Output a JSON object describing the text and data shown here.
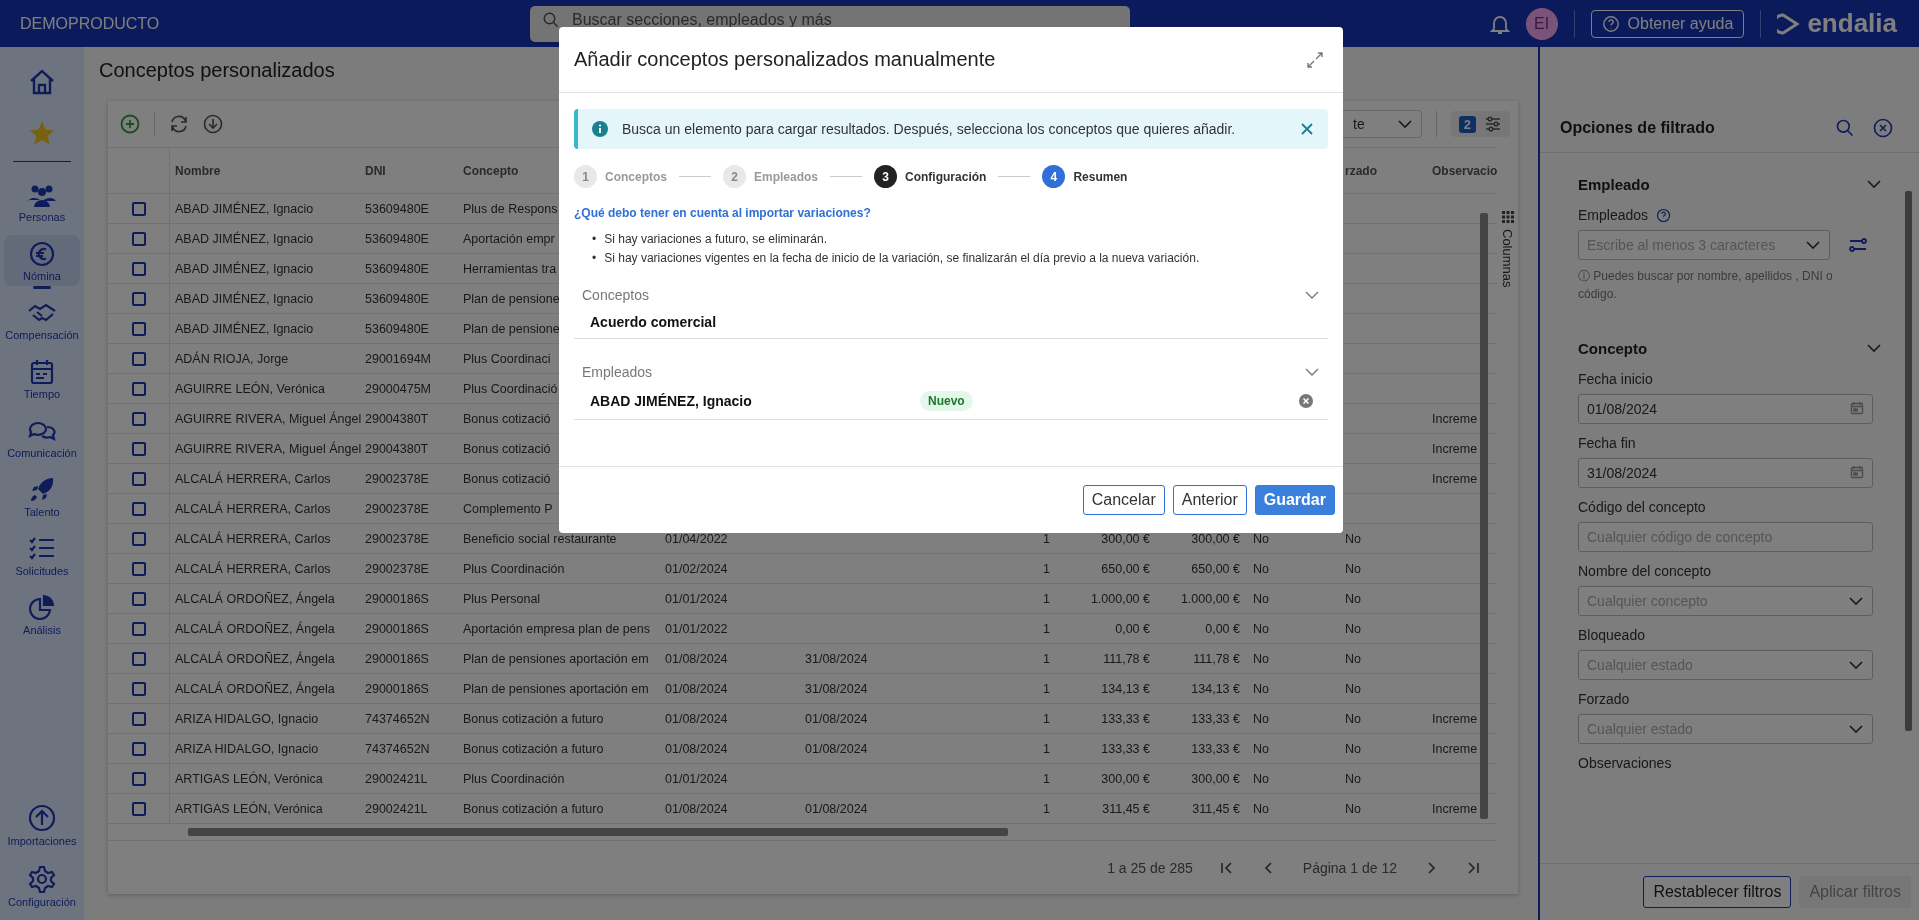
{
  "topbar": {
    "company": "DEMOPRODUCTO",
    "search_placeholder": "Buscar secciones, empleados y más",
    "avatar": "EI",
    "help_button": "Obtener ayuda",
    "logo": "endalia"
  },
  "sidebar": {
    "items": [
      {
        "label": "Personas",
        "selected": false
      },
      {
        "label": "Nómina",
        "selected": true
      },
      {
        "label": "Compensación",
        "selected": false
      },
      {
        "label": "Tiempo",
        "selected": false
      },
      {
        "label": "Comunicación",
        "selected": false
      },
      {
        "label": "Talento",
        "selected": false
      },
      {
        "label": "Solicitudes",
        "selected": false
      },
      {
        "label": "Análisis",
        "selected": false
      }
    ],
    "bottom_items": [
      {
        "label": "Importaciones",
        "selected": false
      },
      {
        "label": "Configuración",
        "selected": false
      }
    ]
  },
  "page_title": "Conceptos personalizados",
  "toolbar": {
    "view_select": "te",
    "filter_count": "2",
    "side_tab": "Columnas"
  },
  "table": {
    "headers": {
      "nombre": "Nombre",
      "dni": "DNI",
      "concepto": "Concepto",
      "column_10": "rzado",
      "column_11": "Observacio"
    },
    "rows": [
      {
        "checked": false,
        "nombre": "ABAD JIMÉNEZ, Ignacio",
        "dni": "53609480E",
        "concepto": "Plus de Respons"
      },
      {
        "checked": false,
        "nombre": "ABAD JIMÉNEZ, Ignacio",
        "dni": "53609480E",
        "concepto": "Aportación empr"
      },
      {
        "checked": false,
        "nombre": "ABAD JIMÉNEZ, Ignacio",
        "dni": "53609480E",
        "concepto": "Herramientas tra"
      },
      {
        "checked": false,
        "nombre": "ABAD JIMÉNEZ, Ignacio",
        "dni": "53609480E",
        "concepto": "Plan de pensione"
      },
      {
        "checked": false,
        "nombre": "ABAD JIMÉNEZ, Ignacio",
        "dni": "53609480E",
        "concepto": "Plan de pensione"
      },
      {
        "checked": false,
        "nombre": "ADÁN RIOJA, Jorge",
        "dni": "29001694M",
        "concepto": "Plus Coordinaci"
      },
      {
        "checked": false,
        "nombre": "AGUIRRE LEÓN, Verónica",
        "dni": "29000475M",
        "concepto": "Plus Coordinació"
      },
      {
        "checked": false,
        "nombre": "AGUIRRE RIVERA, Miguel Ángel",
        "dni": "29004380T",
        "concepto": "Bonus cotizació",
        "column_11": "Increme"
      },
      {
        "checked": false,
        "nombre": "AGUIRRE RIVERA, Miguel Ángel",
        "dni": "29004380T",
        "concepto": "Bonus cotizació",
        "column_11": "Increme"
      },
      {
        "checked": false,
        "nombre": "ALCALÁ HERRERA, Carlos",
        "dni": "29002378E",
        "concepto": "Bonus cotizació",
        "column_11": "Increme"
      },
      {
        "checked": false,
        "nombre": "ALCALÁ HERRERA, Carlos",
        "dni": "29002378E",
        "concepto": "Complemento P"
      },
      {
        "checked": false,
        "nombre": "ALCALÁ HERRERA, Carlos",
        "dni": "29002378E",
        "concepto": "Beneficio social restaurante",
        "column_4": "01/04/2022",
        "column_6": "1",
        "column_7": "300,00 €",
        "column_8": "300,00 €",
        "column_9": "No",
        "column_10": "No"
      },
      {
        "checked": false,
        "nombre": "ALCALÁ HERRERA, Carlos",
        "dni": "29002378E",
        "concepto": "Plus Coordinación",
        "column_4": "01/02/2024",
        "column_6": "1",
        "column_7": "650,00 €",
        "column_8": "650,00 €",
        "column_9": "No",
        "column_10": "No"
      },
      {
        "checked": false,
        "nombre": "ALCALÁ ORDOÑEZ, Ángela",
        "dni": "29000186S",
        "concepto": "Plus Personal",
        "column_4": "01/01/2024",
        "column_6": "1",
        "column_7": "1.000,00 €",
        "column_8": "1.000,00 €",
        "column_9": "No",
        "column_10": "No"
      },
      {
        "checked": false,
        "nombre": "ALCALÁ ORDOÑEZ, Ángela",
        "dni": "29000186S",
        "concepto": "Aportación empresa plan de pens",
        "column_4": "01/01/2022",
        "column_6": "1",
        "column_7": "0,00 €",
        "column_8": "0,00 €",
        "column_9": "No",
        "column_10": "No"
      },
      {
        "checked": false,
        "nombre": "ALCALÁ ORDOÑEZ, Ángela",
        "dni": "29000186S",
        "concepto": "Plan de pensiones aportación em",
        "column_4": "01/08/2024",
        "column_5": "31/08/2024",
        "column_6": "1",
        "column_7": "111,78 €",
        "column_8": "111,78 €",
        "column_9": "No",
        "column_10": "No"
      },
      {
        "checked": false,
        "nombre": "ALCALÁ ORDOÑEZ, Ángela",
        "dni": "29000186S",
        "concepto": "Plan de pensiones aportación em",
        "column_4": "01/08/2024",
        "column_5": "31/08/2024",
        "column_6": "1",
        "column_7": "134,13 €",
        "column_8": "134,13 €",
        "column_9": "No",
        "column_10": "No"
      },
      {
        "checked": false,
        "nombre": "ARIZA HIDALGO, Ignacio",
        "dni": "74374652N",
        "concepto": "Bonus cotización a futuro",
        "column_4": "01/08/2024",
        "column_5": "01/08/2024",
        "column_6": "1",
        "column_7": "133,33 €",
        "column_8": "133,33 €",
        "column_9": "No",
        "column_10": "No",
        "column_11": "Increme"
      },
      {
        "checked": false,
        "nombre": "ARIZA HIDALGO, Ignacio",
        "dni": "74374652N",
        "concepto": "Bonus cotización a futuro",
        "column_4": "01/08/2024",
        "column_5": "01/08/2024",
        "column_6": "1",
        "column_7": "133,33 €",
        "column_8": "133,33 €",
        "column_9": "No",
        "column_10": "No",
        "column_11": "Increme"
      },
      {
        "checked": false,
        "nombre": "ARTIGAS LEÓN, Verónica",
        "dni": "29002421L",
        "concepto": "Plus Coordinación",
        "column_4": "01/01/2024",
        "column_6": "1",
        "column_7": "300,00 €",
        "column_8": "300,00 €",
        "column_9": "No",
        "column_10": "No"
      },
      {
        "checked": false,
        "nombre": "ARTIGAS LEÓN, Verónica",
        "dni": "29002421L",
        "concepto": "Bonus cotización a futuro",
        "column_4": "01/08/2024",
        "column_5": "01/08/2024",
        "column_6": "1",
        "column_7": "311,45 €",
        "column_8": "311,45 €",
        "column_9": "No",
        "column_10": "No",
        "column_11": "Increme"
      }
    ],
    "range": "1 a 25 de 285",
    "page": "Página 1 de 12"
  },
  "filters": {
    "title": "Opciones de filtrado",
    "sections": [
      {
        "title": "Empleado",
        "expanded": true,
        "fields": [
          {
            "kind": "employee",
            "label": "Empleados",
            "placeholder": "Escribe al menos 3 caracteres",
            "hint": "ⓘ Puedes buscar por nombre, apellidos , DNI o código."
          }
        ]
      },
      {
        "title": "Concepto",
        "expanded": true,
        "fields": [
          {
            "kind": "date",
            "label": "Fecha inicio",
            "value": "01/08/2024"
          },
          {
            "kind": "date",
            "label": "Fecha fin",
            "value": "31/08/2024"
          },
          {
            "kind": "text",
            "label": "Código del concepto",
            "placeholder": "Cualquier código de concepto"
          },
          {
            "kind": "select",
            "label": "Nombre del concepto",
            "placeholder": "Cualquier concepto"
          },
          {
            "kind": "select",
            "label": "Bloqueado",
            "placeholder": "Cualquier estado"
          },
          {
            "kind": "select",
            "label": "Forzado",
            "placeholder": "Cualquier estado"
          },
          {
            "kind": "label",
            "label": "Observaciones"
          }
        ]
      }
    ],
    "buttons": [
      {
        "label": "Restablecer filtros",
        "disabled": false
      },
      {
        "label": "Aplicar filtros",
        "disabled": true
      }
    ]
  },
  "modal": {
    "title": "Añadir conceptos personalizados manualmente",
    "alert": "Busca un elemento para cargar resultados. Después, selecciona los conceptos que quieres añadir.",
    "steps": [
      {
        "number": "1",
        "label": "Conceptos",
        "disabled": true,
        "current": false
      },
      {
        "number": "2",
        "label": "Empleados",
        "disabled": true,
        "current": false
      },
      {
        "number": "3",
        "label": "Configuración",
        "disabled": false,
        "current": false
      },
      {
        "number": "4",
        "label": "Resumen",
        "disabled": false,
        "current": true
      }
    ],
    "help_link": "¿Qué debo tener en cuenta al importar variaciones?",
    "bullets": [
      {
        "marker": "•",
        "text": "Si hay variaciones a futuro, se eliminarán."
      },
      {
        "marker": "•",
        "text": "Si hay variaciones vigentes en la fecha de inicio de la variación, se finalizarán el día previo a la nueva variación."
      }
    ],
    "sections": [
      {
        "title": "Conceptos",
        "expanded": true,
        "items": [
          {
            "name": "Acuerdo comercial"
          }
        ]
      },
      {
        "title": "Empleados",
        "expanded": true,
        "items": [
          {
            "name": "ABAD JIMÉNEZ, Ignacio",
            "badge": "Nuevo",
            "removable": true
          }
        ]
      }
    ],
    "buttons": [
      {
        "label": "Cancelar",
        "primary": false
      },
      {
        "label": "Anterior",
        "primary": false
      },
      {
        "label": "Guardar",
        "primary": true
      }
    ]
  }
}
